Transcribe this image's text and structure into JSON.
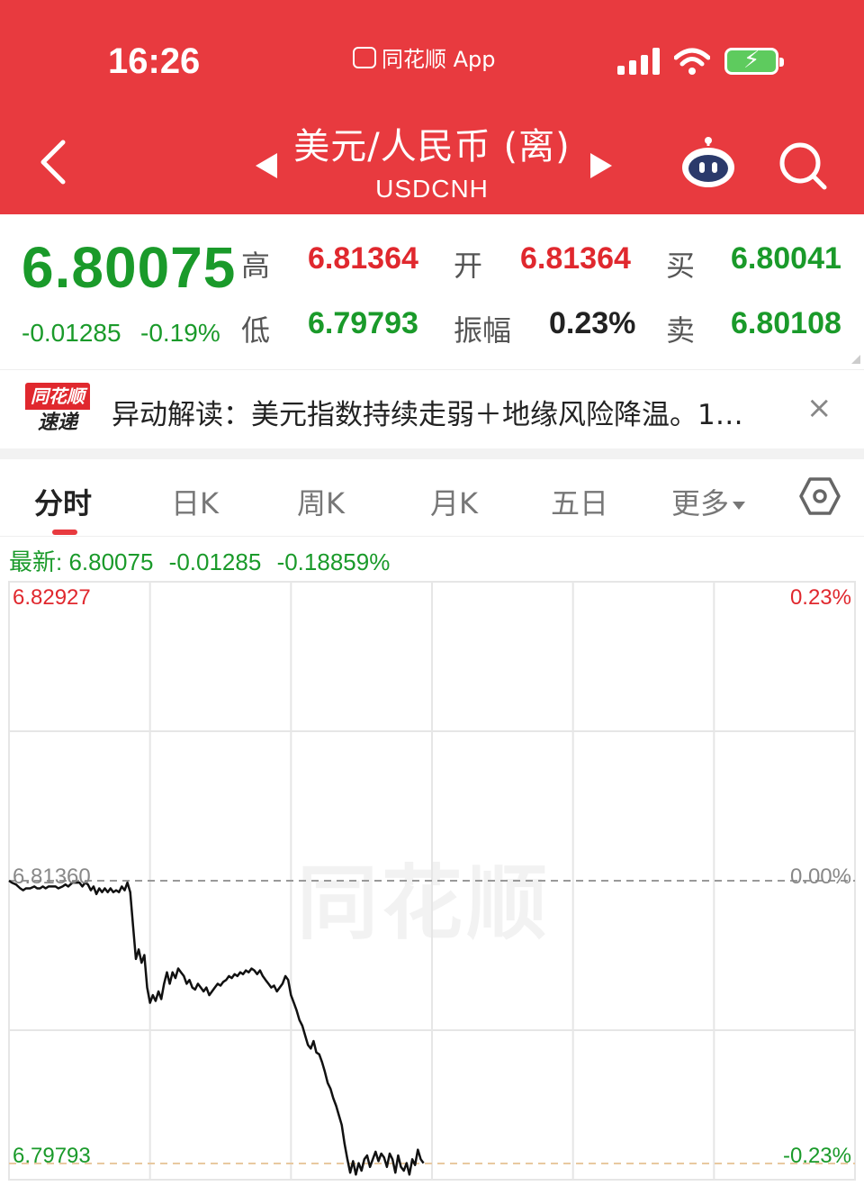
{
  "status_bar": {
    "time": "16:26",
    "app_name": "同花顺 App"
  },
  "nav": {
    "title": "美元/人民币 (离)",
    "subtitle": "USDCNH"
  },
  "quote": {
    "price": "6.80075",
    "change": "-0.01285",
    "change_pct": "-0.19%",
    "high_label": "高",
    "high": "6.81364",
    "low_label": "低",
    "low": "6.79793",
    "open_label": "开",
    "open": "6.81364",
    "amplitude_label": "振幅",
    "amplitude": "0.23%",
    "buy_label": "买",
    "buy": "6.80041",
    "sell_label": "卖",
    "sell": "6.80108"
  },
  "news": {
    "logo_top": "同花顺",
    "logo_bottom": "速递",
    "text": "异动解读：美元指数持续走弱＋地缘风险降温。1…",
    "close": "×"
  },
  "tabs": [
    {
      "label": "分时"
    },
    {
      "label": "日K"
    },
    {
      "label": "周K"
    },
    {
      "label": "月K"
    },
    {
      "label": "五日"
    },
    {
      "label": "更多"
    }
  ],
  "latest": {
    "label": "最新: 6.80075",
    "change": "-0.01285",
    "change_pct": "-0.18859%"
  },
  "chart_data": {
    "type": "line",
    "y_axis_left": {
      "top": "6.82927",
      "mid": "6.81360",
      "bottom": "6.79793"
    },
    "y_axis_right": {
      "top": "0.23%",
      "mid": "0.00%",
      "bottom": "-0.23%"
    },
    "ylim": [
      6.79793,
      6.82927
    ],
    "reference": 6.8136,
    "watermark": "同花顺",
    "x": [
      0,
      2,
      5,
      8,
      10,
      12,
      15,
      18,
      20,
      22,
      24,
      26,
      28,
      30,
      33,
      35,
      38,
      40,
      42,
      45,
      48,
      50,
      52,
      54,
      56,
      58,
      60,
      62,
      64,
      66,
      68,
      70,
      72,
      74,
      76,
      78,
      80,
      82,
      84,
      86,
      88,
      90,
      92,
      94,
      96,
      98,
      100,
      102,
      104,
      106,
      108,
      110,
      112,
      114,
      116,
      118,
      120,
      122,
      124,
      126,
      128,
      130,
      132,
      134,
      136,
      138,
      140,
      142,
      144,
      146,
      148,
      150,
      152,
      154,
      156,
      158,
      160,
      162,
      164,
      166,
      168,
      170,
      172,
      174,
      176,
      178,
      180,
      182,
      184,
      186,
      188,
      190,
      192,
      194,
      196,
      198,
      200,
      202,
      204,
      206,
      208,
      210,
      212,
      214,
      216,
      218,
      220,
      222,
      224,
      226,
      228,
      230,
      232,
      234,
      236,
      238,
      240,
      242,
      244,
      246,
      248,
      250,
      252,
      254,
      256,
      258,
      260,
      262,
      264,
      266,
      268,
      270,
      272,
      274,
      276,
      278,
      280,
      282,
      284,
      286,
      288,
      290,
      292,
      294
    ],
    "y": [
      6.8136,
      6.8135,
      6.8134,
      6.8132,
      6.8131,
      6.8132,
      6.8132,
      6.8133,
      6.8132,
      6.8132,
      6.8133,
      6.8132,
      6.8133,
      6.8133,
      6.8133,
      6.8132,
      6.8133,
      6.8134,
      6.8133,
      6.8135,
      6.8135,
      6.8135,
      6.8133,
      6.8135,
      6.8134,
      6.8131,
      6.8133,
      6.8129,
      6.8132,
      6.813,
      6.8132,
      6.813,
      6.8132,
      6.813,
      6.8131,
      6.813,
      6.8133,
      6.8131,
      6.8135,
      6.813,
      6.8112,
      6.8095,
      6.81,
      6.8093,
      6.8097,
      6.808,
      6.8072,
      6.8076,
      6.8073,
      6.8078,
      6.8074,
      6.8082,
      6.8088,
      6.8082,
      6.8088,
      6.8085,
      6.809,
      6.8088,
      6.8086,
      6.8082,
      6.8084,
      6.808,
      6.8079,
      6.8082,
      6.808,
      6.8078,
      6.808,
      6.8076,
      6.8078,
      6.808,
      6.8082,
      6.8081,
      6.8083,
      6.8084,
      6.8086,
      6.8085,
      6.8087,
      6.8086,
      6.8088,
      6.8087,
      6.8089,
      6.8088,
      6.809,
      6.8089,
      6.8087,
      6.8089,
      6.8086,
      6.8084,
      6.8082,
      6.808,
      6.8081,
      6.8078,
      6.808,
      6.8082,
      6.8086,
      6.8084,
      6.8076,
      6.8072,
      6.8068,
      6.8063,
      6.806,
      6.8055,
      6.805,
      6.8048,
      6.8052,
      6.8046,
      6.8045,
      6.8041,
      6.8036,
      6.803,
      6.8027,
      6.8022,
      6.8018,
      6.8013,
      6.8008,
      6.7998,
      6.799,
      6.7983,
      6.7989,
      6.7982,
      6.7988,
      6.7984,
      6.799,
      6.7992,
      6.7986,
      6.799,
      6.7994,
      6.7989,
      6.7993,
      6.7991,
      6.7986,
      6.7993,
      6.799,
      6.7983,
      6.7992,
      6.7986,
      6.7984,
      6.7988,
      6.7982,
      6.799,
      6.7987,
      6.7995,
      6.799,
      6.7988
    ],
    "colors": {
      "line": "#111111",
      "grid": "#e6e6e6",
      "up": "#e0282e",
      "down": "#1a9a2a"
    }
  },
  "colors": {
    "header_bg": "#e83a3f",
    "up": "#e0282e",
    "down": "#1a9a2a"
  }
}
